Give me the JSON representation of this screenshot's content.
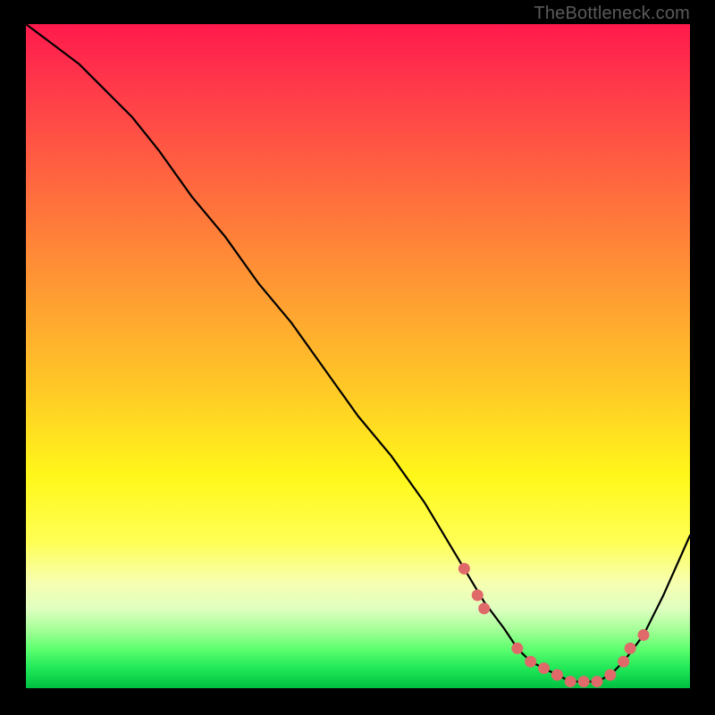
{
  "watermark": {
    "text": "TheBottleneck.com"
  },
  "colors": {
    "background": "#000000",
    "curve": "#000000",
    "marker": "#e06a6a",
    "marker_stroke": "#c94f4f"
  },
  "chart_data": {
    "type": "line",
    "title": "",
    "xlabel": "",
    "ylabel": "",
    "xlim": [
      0,
      100
    ],
    "ylim": [
      0,
      100
    ],
    "grid": false,
    "legend": false,
    "series": [
      {
        "name": "bottleneck-curve",
        "x": [
          0,
          4,
          8,
          12,
          16,
          20,
          25,
          30,
          35,
          40,
          45,
          50,
          55,
          60,
          63,
          66,
          69,
          72,
          74,
          76,
          78,
          80,
          82,
          84,
          86,
          88,
          90,
          93,
          96,
          100
        ],
        "values": [
          100,
          97,
          94,
          90,
          86,
          81,
          74,
          68,
          61,
          55,
          48,
          41,
          35,
          28,
          23,
          18,
          13,
          9,
          6,
          4,
          3,
          2,
          1,
          1,
          1,
          2,
          4,
          8,
          14,
          23
        ]
      }
    ],
    "markers": {
      "series": "bottleneck-curve",
      "points": [
        {
          "x": 66,
          "y": 18
        },
        {
          "x": 68,
          "y": 14
        },
        {
          "x": 69,
          "y": 12
        },
        {
          "x": 74,
          "y": 6
        },
        {
          "x": 76,
          "y": 4
        },
        {
          "x": 78,
          "y": 3
        },
        {
          "x": 80,
          "y": 2
        },
        {
          "x": 82,
          "y": 1
        },
        {
          "x": 84,
          "y": 1
        },
        {
          "x": 86,
          "y": 1
        },
        {
          "x": 88,
          "y": 2
        },
        {
          "x": 90,
          "y": 4
        },
        {
          "x": 91,
          "y": 6
        },
        {
          "x": 93,
          "y": 8
        }
      ]
    }
  }
}
